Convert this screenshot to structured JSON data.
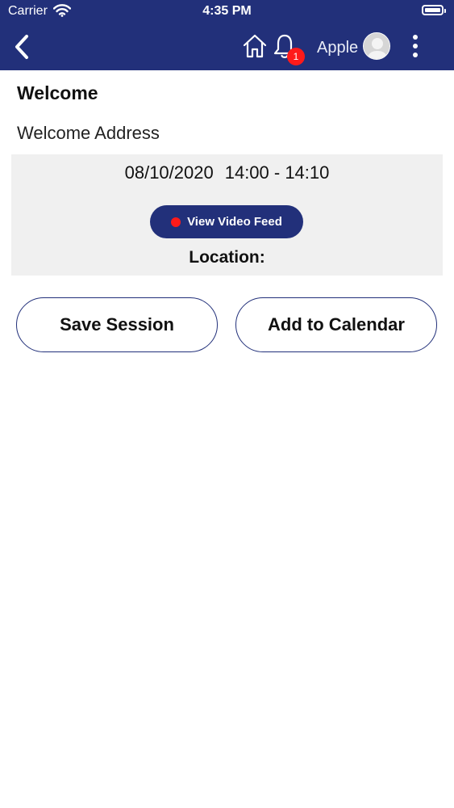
{
  "status_bar": {
    "carrier": "Carrier",
    "time": "4:35 PM",
    "icons": [
      "wifi-icon",
      "battery-icon"
    ]
  },
  "nav": {
    "icons": [
      "back-chevron-icon",
      "home-icon",
      "bell-icon",
      "avatar-icon",
      "more-vertical-icon"
    ],
    "notification_count": "1",
    "user_name": "Apple",
    "colors": {
      "bar": "#22307a",
      "badge": "#ff1a1a"
    }
  },
  "session": {
    "title": "Welcome",
    "subtitle": "Welcome Address",
    "date": "08/10/2020",
    "time_range": "14:00 - 14:10",
    "video_button": "View Video Feed",
    "location_label": "Location:"
  },
  "actions": {
    "save_label": "Save Session",
    "calendar_label": "Add to Calendar"
  }
}
